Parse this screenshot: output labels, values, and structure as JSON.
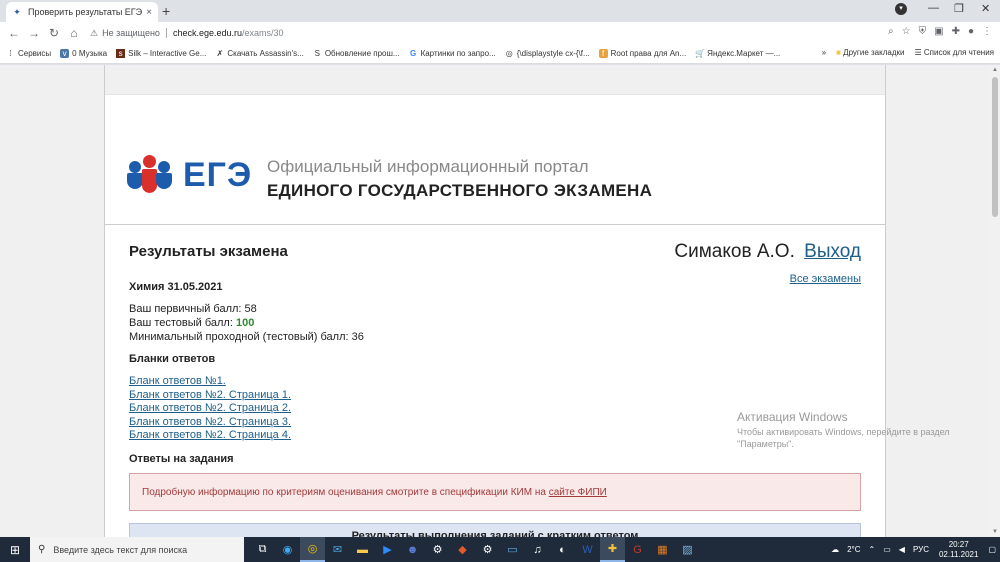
{
  "browser": {
    "tab_title": "Проверить результаты ЕГЭ / Ос",
    "tab_close": "×",
    "new_tab": "+",
    "omnibox": {
      "security_label": "Не защищено",
      "url_host": "check.ege.edu.ru",
      "url_path": "/exams/30"
    },
    "bookmarks": [
      {
        "label": "Сервисы",
        "icon": "apps-icon"
      },
      {
        "label": "0 Музыка",
        "icon": "vk-icon"
      },
      {
        "label": "Silk – Interactive Ge...",
        "icon": "silk-icon"
      },
      {
        "label": "Скачать Assassin's...",
        "icon": "download-icon"
      },
      {
        "label": "Обновление прош...",
        "icon": "update-icon"
      },
      {
        "label": "Картинки по запро...",
        "icon": "google-icon"
      },
      {
        "label": "{\\displaystyle cx-{\\f...",
        "icon": "wiki-icon"
      },
      {
        "label": "Root права для An...",
        "icon": "android-icon"
      },
      {
        "label": "Яндекс.Маркет —...",
        "icon": "market-icon"
      }
    ],
    "bookmarks_more": "»",
    "other_bookmarks": "Другие закладки",
    "reading_list": "Список для чтения"
  },
  "site": {
    "logo_text": "ЕГЭ",
    "portal_subtitle": "Официальный информационный портал",
    "portal_title": "ЕДИНОГО ГОСУДАРСТВЕННОГО ЭКЗАМЕНА"
  },
  "results": {
    "page_title": "Результаты экзамена",
    "user_name": "Симаков А.О.",
    "logout_label": "Выход",
    "all_exams_label": "Все экзамены",
    "exam_name": "Химия 31.05.2021",
    "primary_score_label": "Ваш первичный балл: ",
    "primary_score": "58",
    "test_score_label": "Ваш тестовый балл: ",
    "test_score": "100",
    "min_score_label": "Минимальный проходной (тестовый) балл: ",
    "min_score": "36",
    "blanks_heading": "Бланки ответов",
    "blanks": [
      "Бланк ответов №1.",
      "Бланк ответов №2. Страница 1.",
      "Бланк ответов №2. Страница 2.",
      "Бланк ответов №2. Страница 3.",
      "Бланк ответов №2. Страница 4."
    ],
    "answers_heading": "Ответы на задания",
    "alert_text": "Подробную информацию по критериям оценивания смотрите в спецификации КИМ на ",
    "alert_link": "сайте ФИПИ",
    "table_heading": "Результаты выполнения заданий с кратким ответом"
  },
  "activation": {
    "title": "Активация Windows",
    "text": "Чтобы активировать Windows, перейдите в раздел \"Параметры\"."
  },
  "taskbar": {
    "search_placeholder": "Введите здесь текст для поиска",
    "weather": "2°C",
    "language": "РУС",
    "time": "20:27",
    "date": "02.11.2021"
  }
}
